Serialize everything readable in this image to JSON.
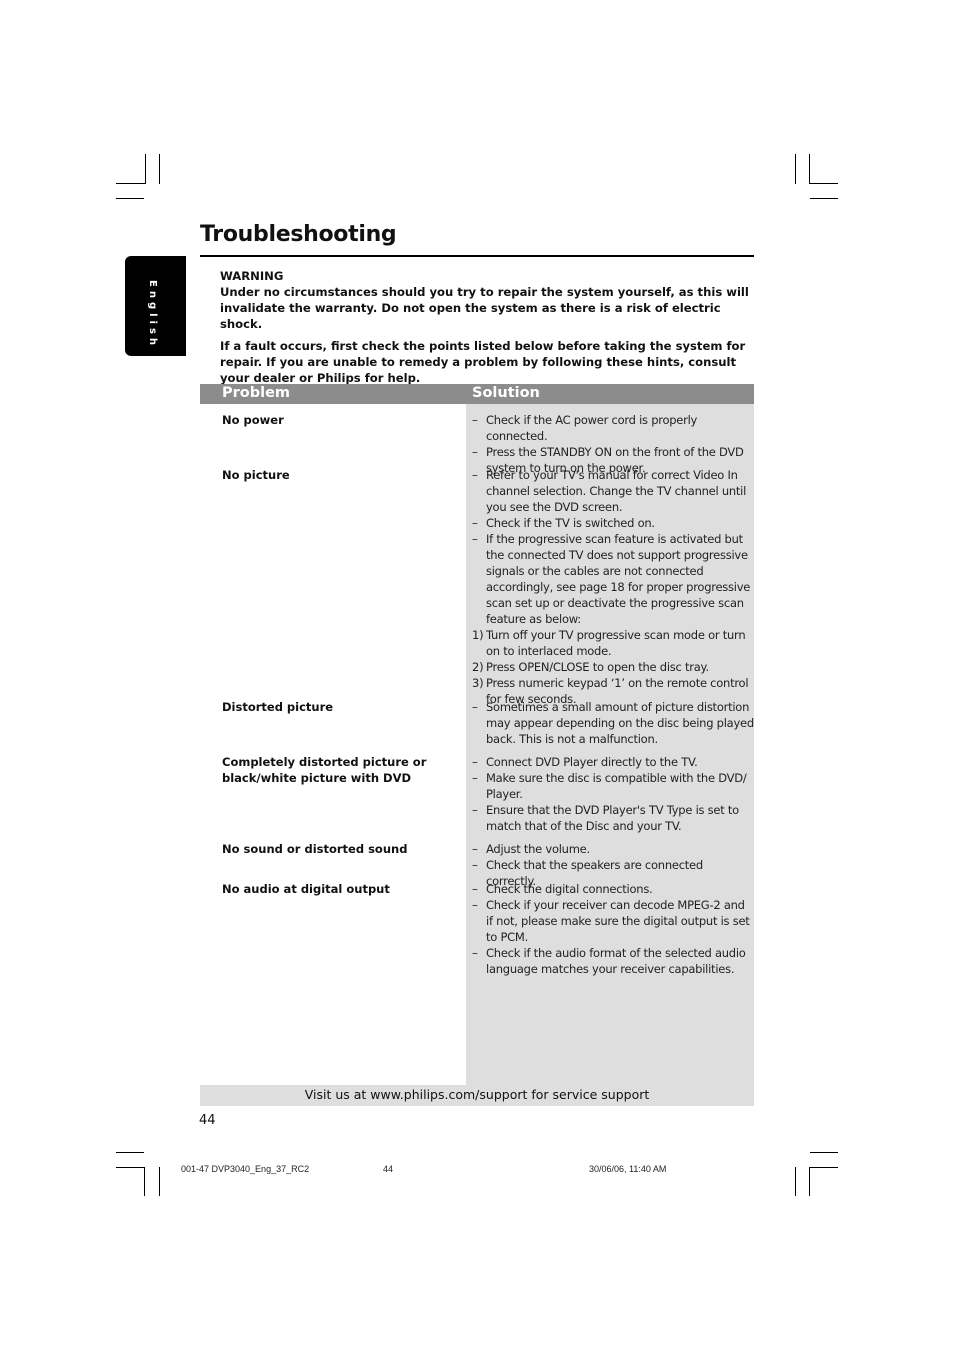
{
  "page": {
    "title": "Troubleshooting",
    "language_tab": "English",
    "page_number": "44"
  },
  "intro": {
    "warning_heading": "WARNING",
    "warning_text": "Under no circumstances should you try to repair the system yourself, as this will invalidate the warranty.  Do not open the system as there is a risk of electric shock.",
    "fault_text": "If a fault occurs, first check the points listed below before taking the system for repair. If you are unable to remedy a problem by following these hints, consult your dealer or Philips for help."
  },
  "table": {
    "header_problem": "Problem",
    "header_solution": "Solution",
    "rows": [
      {
        "problem": "No power",
        "solutions": [
          {
            "marker": "–",
            "text": "Check if the AC power cord is properly connected."
          },
          {
            "marker": "–",
            "text": "Press the STANDBY ON on the front of the DVD system to turn on the power."
          }
        ]
      },
      {
        "problem": "No picture",
        "solutions": [
          {
            "marker": "–",
            "text": "Refer to your TV's manual for correct Video In channel selection.  Change the TV channel until you see the DVD screen."
          },
          {
            "marker": "–",
            "text": "Check if the TV is switched on."
          },
          {
            "marker": "–",
            "text": "If the progressive scan feature is activated but the connected TV does not support progressive signals or the cables are not connected accordingly, see page 18 for proper progressive scan set up or deactivate the progressive scan feature as below:"
          },
          {
            "marker": "1)",
            "text": "Turn off your TV progressive scan mode or turn on to interlaced mode."
          },
          {
            "marker": "2)",
            "text": "Press OPEN/CLOSE to open the disc tray."
          },
          {
            "marker": "3)",
            "text": "Press numeric keypad ‘1’ on the remote control for few seconds."
          }
        ]
      },
      {
        "problem": "Distorted picture",
        "solutions": [
          {
            "marker": "–",
            "text": "Sometimes a small amount of picture distortion may appear depending on the disc being played back. This is not a malfunction."
          }
        ]
      },
      {
        "problem": "Completely distorted picture or black/white picture with DVD",
        "solutions": [
          {
            "marker": "–",
            "text": "Connect DVD Player directly to the TV."
          },
          {
            "marker": "–",
            "text": "Make sure the disc is compatible with the DVD/ Player."
          },
          {
            "marker": "–",
            "text": "Ensure that the DVD Player's TV Type is set to match that of the Disc and your TV."
          }
        ]
      },
      {
        "problem": "No sound or distorted sound",
        "solutions": [
          {
            "marker": "–",
            "text": "Adjust the volume."
          },
          {
            "marker": "–",
            "text": "Check that the speakers are connected correctly."
          }
        ]
      },
      {
        "problem": "No audio at digital output",
        "solutions": [
          {
            "marker": "–",
            "text": "Check the digital connections."
          },
          {
            "marker": "–",
            "text": "Check if your receiver can decode MPEG-2 and if not, please make sure the digital output is set to PCM."
          },
          {
            "marker": "–",
            "text": "Check if the audio format of the selected audio language matches your receiver capabilities."
          }
        ]
      }
    ]
  },
  "footer": {
    "support_text": "Visit us at www.philips.com/support for service support"
  },
  "print_slug": {
    "file": "001-47 DVP3040_Eng_37_RC2",
    "page": "44",
    "timestamp": "30/06/06, 11:40 AM"
  },
  "colors": {
    "header_bar": "#8c8c8c",
    "solution_background": "#dedede",
    "tab_background": "#000000"
  }
}
